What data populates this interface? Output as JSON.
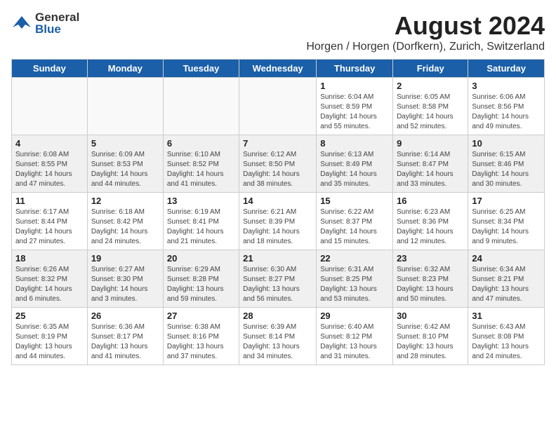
{
  "header": {
    "logo_general": "General",
    "logo_blue": "Blue",
    "month_year": "August 2024",
    "location": "Horgen / Horgen (Dorfkern), Zurich, Switzerland"
  },
  "days_of_week": [
    "Sunday",
    "Monday",
    "Tuesday",
    "Wednesday",
    "Thursday",
    "Friday",
    "Saturday"
  ],
  "weeks": [
    [
      {
        "num": "",
        "info": ""
      },
      {
        "num": "",
        "info": ""
      },
      {
        "num": "",
        "info": ""
      },
      {
        "num": "",
        "info": ""
      },
      {
        "num": "1",
        "info": "Sunrise: 6:04 AM\nSunset: 8:59 PM\nDaylight: 14 hours\nand 55 minutes."
      },
      {
        "num": "2",
        "info": "Sunrise: 6:05 AM\nSunset: 8:58 PM\nDaylight: 14 hours\nand 52 minutes."
      },
      {
        "num": "3",
        "info": "Sunrise: 6:06 AM\nSunset: 8:56 PM\nDaylight: 14 hours\nand 49 minutes."
      }
    ],
    [
      {
        "num": "4",
        "info": "Sunrise: 6:08 AM\nSunset: 8:55 PM\nDaylight: 14 hours\nand 47 minutes."
      },
      {
        "num": "5",
        "info": "Sunrise: 6:09 AM\nSunset: 8:53 PM\nDaylight: 14 hours\nand 44 minutes."
      },
      {
        "num": "6",
        "info": "Sunrise: 6:10 AM\nSunset: 8:52 PM\nDaylight: 14 hours\nand 41 minutes."
      },
      {
        "num": "7",
        "info": "Sunrise: 6:12 AM\nSunset: 8:50 PM\nDaylight: 14 hours\nand 38 minutes."
      },
      {
        "num": "8",
        "info": "Sunrise: 6:13 AM\nSunset: 8:49 PM\nDaylight: 14 hours\nand 35 minutes."
      },
      {
        "num": "9",
        "info": "Sunrise: 6:14 AM\nSunset: 8:47 PM\nDaylight: 14 hours\nand 33 minutes."
      },
      {
        "num": "10",
        "info": "Sunrise: 6:15 AM\nSunset: 8:46 PM\nDaylight: 14 hours\nand 30 minutes."
      }
    ],
    [
      {
        "num": "11",
        "info": "Sunrise: 6:17 AM\nSunset: 8:44 PM\nDaylight: 14 hours\nand 27 minutes."
      },
      {
        "num": "12",
        "info": "Sunrise: 6:18 AM\nSunset: 8:42 PM\nDaylight: 14 hours\nand 24 minutes."
      },
      {
        "num": "13",
        "info": "Sunrise: 6:19 AM\nSunset: 8:41 PM\nDaylight: 14 hours\nand 21 minutes."
      },
      {
        "num": "14",
        "info": "Sunrise: 6:21 AM\nSunset: 8:39 PM\nDaylight: 14 hours\nand 18 minutes."
      },
      {
        "num": "15",
        "info": "Sunrise: 6:22 AM\nSunset: 8:37 PM\nDaylight: 14 hours\nand 15 minutes."
      },
      {
        "num": "16",
        "info": "Sunrise: 6:23 AM\nSunset: 8:36 PM\nDaylight: 14 hours\nand 12 minutes."
      },
      {
        "num": "17",
        "info": "Sunrise: 6:25 AM\nSunset: 8:34 PM\nDaylight: 14 hours\nand 9 minutes."
      }
    ],
    [
      {
        "num": "18",
        "info": "Sunrise: 6:26 AM\nSunset: 8:32 PM\nDaylight: 14 hours\nand 6 minutes."
      },
      {
        "num": "19",
        "info": "Sunrise: 6:27 AM\nSunset: 8:30 PM\nDaylight: 14 hours\nand 3 minutes."
      },
      {
        "num": "20",
        "info": "Sunrise: 6:29 AM\nSunset: 8:28 PM\nDaylight: 13 hours\nand 59 minutes."
      },
      {
        "num": "21",
        "info": "Sunrise: 6:30 AM\nSunset: 8:27 PM\nDaylight: 13 hours\nand 56 minutes."
      },
      {
        "num": "22",
        "info": "Sunrise: 6:31 AM\nSunset: 8:25 PM\nDaylight: 13 hours\nand 53 minutes."
      },
      {
        "num": "23",
        "info": "Sunrise: 6:32 AM\nSunset: 8:23 PM\nDaylight: 13 hours\nand 50 minutes."
      },
      {
        "num": "24",
        "info": "Sunrise: 6:34 AM\nSunset: 8:21 PM\nDaylight: 13 hours\nand 47 minutes."
      }
    ],
    [
      {
        "num": "25",
        "info": "Sunrise: 6:35 AM\nSunset: 8:19 PM\nDaylight: 13 hours\nand 44 minutes."
      },
      {
        "num": "26",
        "info": "Sunrise: 6:36 AM\nSunset: 8:17 PM\nDaylight: 13 hours\nand 41 minutes."
      },
      {
        "num": "27",
        "info": "Sunrise: 6:38 AM\nSunset: 8:16 PM\nDaylight: 13 hours\nand 37 minutes."
      },
      {
        "num": "28",
        "info": "Sunrise: 6:39 AM\nSunset: 8:14 PM\nDaylight: 13 hours\nand 34 minutes."
      },
      {
        "num": "29",
        "info": "Sunrise: 6:40 AM\nSunset: 8:12 PM\nDaylight: 13 hours\nand 31 minutes."
      },
      {
        "num": "30",
        "info": "Sunrise: 6:42 AM\nSunset: 8:10 PM\nDaylight: 13 hours\nand 28 minutes."
      },
      {
        "num": "31",
        "info": "Sunrise: 6:43 AM\nSunset: 8:08 PM\nDaylight: 13 hours\nand 24 minutes."
      }
    ]
  ]
}
